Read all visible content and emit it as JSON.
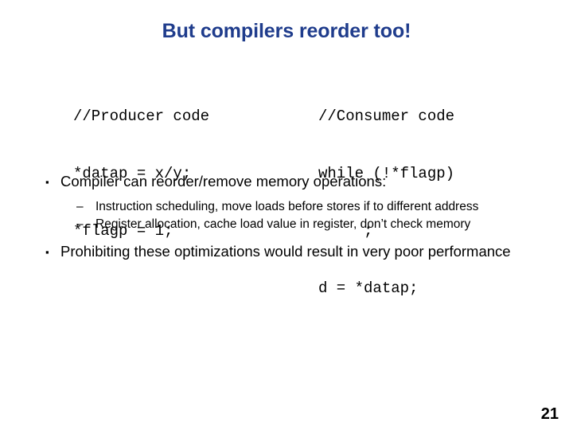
{
  "slide": {
    "title": "But compilers reorder too!",
    "title_color": "#1F3C8C",
    "background_color": "#FFFFFF",
    "text_color": "#000000",
    "page_number": "21"
  },
  "code": {
    "producer": {
      "label": "producer-code",
      "lines": [
        "//Producer code",
        "*datap = x/y;",
        "*flagp = 1;"
      ],
      "line_0": "//Producer code",
      "line_1": "*datap = x/y;",
      "line_2": "*flagp = 1;"
    },
    "consumer": {
      "label": "consumer-code",
      "lines": [
        "//Consumer code",
        "while (!*flagp)",
        "     ;",
        "d = *datap;"
      ],
      "line_0": "//Consumer code",
      "line_1": "while (!*flagp)",
      "line_2": "     ;",
      "line_3": "d = *datap;"
    }
  },
  "bullets": {
    "marker_level1": "▪",
    "marker_level2": "–",
    "items": [
      {
        "level": 1,
        "text": "Compiler can reorder/remove memory operations:"
      },
      {
        "level": 2,
        "text": "Instruction scheduling, move loads before stores if to different address"
      },
      {
        "level": 2,
        "text": "Register allocation, cache load value in register, don’t check memory"
      },
      {
        "level": 1,
        "text": "Prohibiting these optimizations would result in very poor performance"
      }
    ],
    "item_0": "Compiler can reorder/remove memory operations:",
    "item_1": "Instruction scheduling, move loads before stores if to different address",
    "item_2": "Register allocation, cache load value in register, don’t check memory",
    "item_3": "Prohibiting these optimizations would result in very poor performance"
  }
}
